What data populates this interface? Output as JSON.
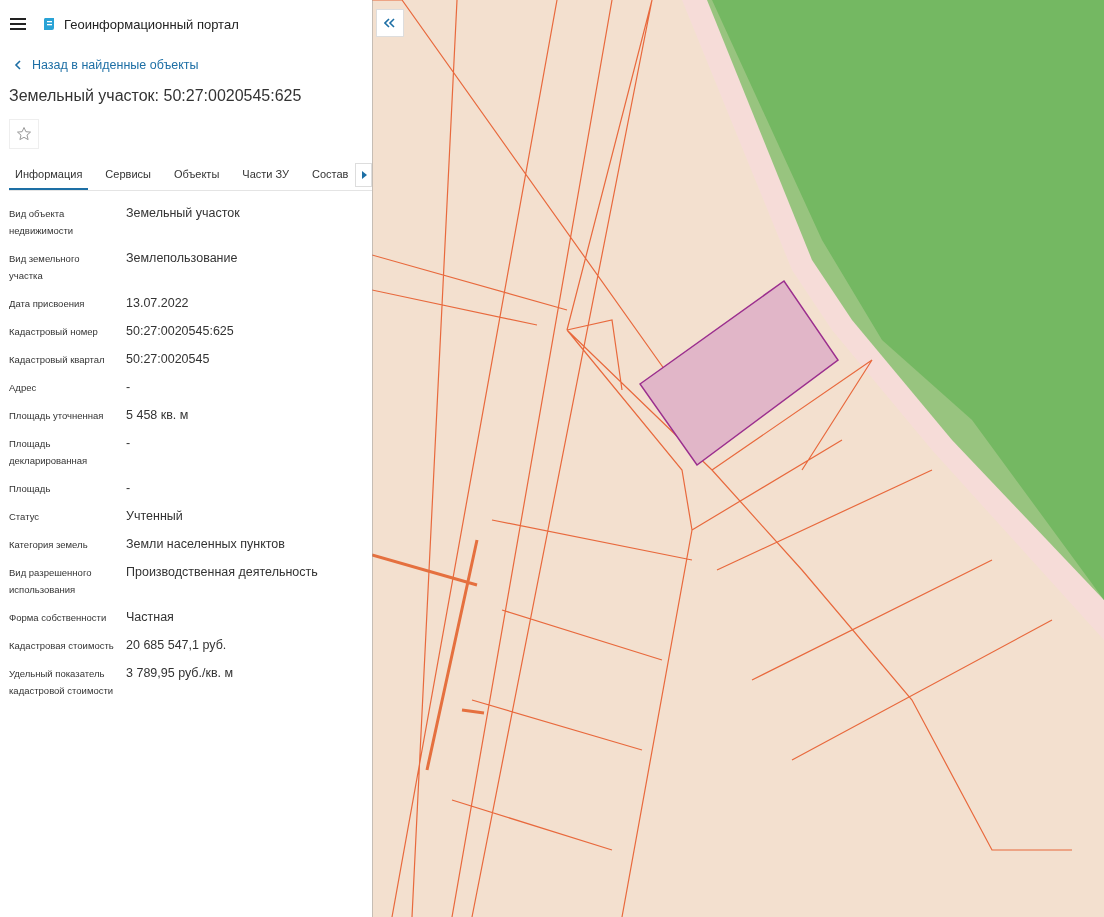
{
  "header": {
    "title": "Геоинформационный портал"
  },
  "back_link": "Назад в найденные объекты",
  "heading": "Земельный участок: 50:27:0020545:625",
  "tabs": [
    {
      "label": "Информация",
      "selected": true
    },
    {
      "label": "Сервисы",
      "selected": false
    },
    {
      "label": "Объекты",
      "selected": false
    },
    {
      "label": "Части ЗУ",
      "selected": false
    },
    {
      "label": "Состав",
      "selected": false
    }
  ],
  "properties": [
    {
      "label": "Вид объекта недвижимости",
      "value": "Земельный участок"
    },
    {
      "label": "Вид земельного участка",
      "value": "Землепользование"
    },
    {
      "label": "Дата присвоения",
      "value": "13.07.2022"
    },
    {
      "label": "Кадастровый номер",
      "value": "50:27:0020545:625"
    },
    {
      "label": "Кадастровый квартал",
      "value": "50:27:0020545"
    },
    {
      "label": "Адрес",
      "value": "-"
    },
    {
      "label": "Площадь уточненная",
      "value": "5 458 кв. м"
    },
    {
      "label": "Площадь декларированная",
      "value": "-"
    },
    {
      "label": "Площадь",
      "value": "-"
    },
    {
      "label": "Статус",
      "value": "Учтенный"
    },
    {
      "label": "Категория земель",
      "value": "Земли населенных пунктов"
    },
    {
      "label": "Вид разрешенного использования",
      "value": "Производственная деятельность"
    },
    {
      "label": "Форма собственности",
      "value": "Частная"
    },
    {
      "label": "Кадастровая стоимость",
      "value": "20 685 547,1 руб."
    },
    {
      "label": "Удельный показатель кадастровой стоимости",
      "value": "3 789,95 руб./кв. м"
    }
  ]
}
